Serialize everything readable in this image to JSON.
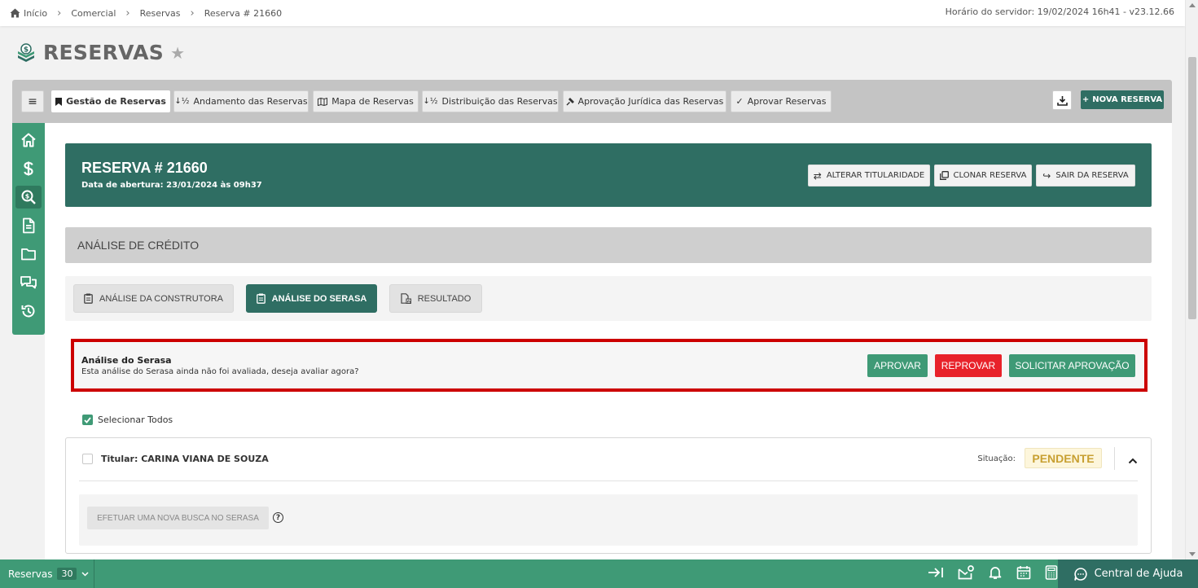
{
  "breadcrumb": {
    "items": [
      "Início",
      "Comercial",
      "Reservas",
      "Reserva # 21660"
    ]
  },
  "server_info": "Horário do servidor: 19/02/2024 16h41 - v23.12.66",
  "page": {
    "title": "RESERVAS"
  },
  "toolbar": {
    "menu_label": "≡",
    "tabs": [
      {
        "label": "Gestão de Reservas",
        "active": true
      },
      {
        "label": "Andamento das Reservas"
      },
      {
        "label": "Mapa de Reservas"
      },
      {
        "label": "Distribuição das Reservas"
      },
      {
        "label": "Aprovação Jurídica das Reservas"
      },
      {
        "label": "Aprovar Reservas"
      }
    ],
    "nova_reserva": "NOVA RESERVA"
  },
  "sidenav": {
    "items": [
      "home-icon",
      "dollar-icon",
      "search-dollar-icon",
      "document-icon",
      "folder-icon",
      "chat-icon",
      "history-icon"
    ]
  },
  "reserva": {
    "title": "RESERVA # 21660",
    "subtitle": "Data de abertura: 23/01/2024 às 09h37",
    "buttons": {
      "alterar": "ALTERAR TITULARIDADE",
      "clonar": "CLONAR RESERVA",
      "sair": "SAIR DA RESERVA"
    }
  },
  "analise": {
    "section_title": "ANÁLISE DE CRÉDITO",
    "tabs": [
      {
        "label": "ANÁLISE DA CONSTRUTORA"
      },
      {
        "label": "ANÁLISE DO SERASA",
        "active": true
      },
      {
        "label": "RESULTADO"
      }
    ],
    "alert": {
      "title": "Análise do Serasa",
      "message": "Esta análise do Serasa ainda não foi avaliada, deseja avaliar agora?",
      "aprovar": "APROVAR",
      "reprovar": "REPROVAR",
      "solicitar": "SOLICITAR APROVAÇÃO"
    },
    "select_all": "Selecionar Todos",
    "titular": {
      "label": "Titular: CARINA VIANA DE SOUZA",
      "situacao_label": "Situação:",
      "status": "PENDENTE",
      "busca_button": "EFETUAR UMA NOVA BUSCA NO SERASA",
      "help": "?"
    }
  },
  "bottombar": {
    "module": "Reservas",
    "count": "30",
    "help": "Central de Ajuda"
  },
  "colors": {
    "primary": "#2f6e63",
    "green": "#3f9a76",
    "danger": "#e8222a",
    "alert_border": "#cc0000",
    "pending_text": "#c8a032"
  }
}
